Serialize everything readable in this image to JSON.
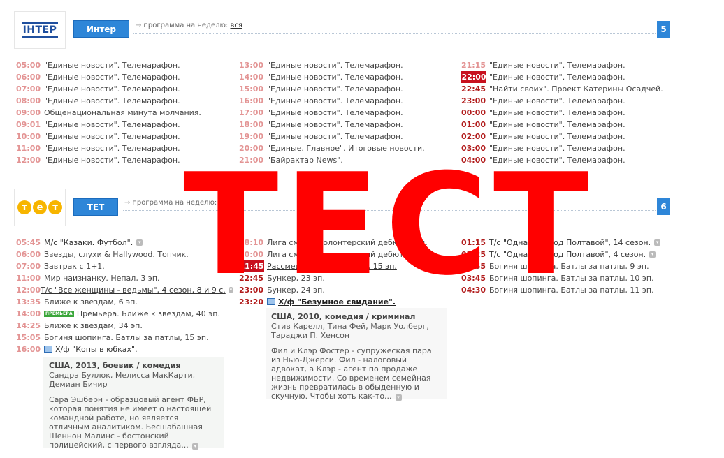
{
  "channels": [
    {
      "logo_text": "ІНТЕР",
      "button_label": "Интер",
      "week_label": "программа на неделю:",
      "week_link": "вся",
      "number": "5",
      "columns": [
        [
          {
            "time": "05:00",
            "title": "\"Единые новости\". Телемарафон."
          },
          {
            "time": "06:00",
            "title": "\"Единые новости\". Телемарафон."
          },
          {
            "time": "07:00",
            "title": "\"Единые новости\". Телемарафон."
          },
          {
            "time": "08:00",
            "title": "\"Единые новости\". Телемарафон."
          },
          {
            "time": "09:00",
            "title": "Общенациональная минута молчания."
          },
          {
            "time": "09:01",
            "title": "\"Единые новости\". Телемарафон."
          },
          {
            "time": "10:00",
            "title": "\"Единые новости\". Телемарафон."
          },
          {
            "time": "11:00",
            "title": "\"Единые новости\". Телемарафон."
          },
          {
            "time": "12:00",
            "title": "\"Единые новости\". Телемарафон."
          }
        ],
        [
          {
            "time": "13:00",
            "title": "\"Единые новости\". Телемарафон."
          },
          {
            "time": "14:00",
            "title": "\"Единые новости\". Телемарафон."
          },
          {
            "time": "15:00",
            "title": "\"Единые новости\". Телемарафон."
          },
          {
            "time": "16:00",
            "title": "\"Единые новости\". Телемарафон."
          },
          {
            "time": "17:00",
            "title": "\"Единые новости\". Телемарафон."
          },
          {
            "time": "18:00",
            "title": "\"Единые новости\". Телемарафон."
          },
          {
            "time": "19:00",
            "title": "\"Единые новости\". Телемарафон."
          },
          {
            "time": "20:00",
            "title": "\"Единые. Главное\". Итоговые новости."
          },
          {
            "time": "21:00",
            "title": "\"Байрактар News\"."
          }
        ],
        [
          {
            "time": "21:15",
            "title": "\"Единые новости\". Телемарафон."
          },
          {
            "time": "22:00",
            "title": "\"Единые новости\". Телемарафон."
          },
          {
            "time": "22:45",
            "title": "\"Найти своих\". Проект Катерины Осадчей."
          },
          {
            "time": "23:00",
            "title": "\"Единые новости\". Телемарафон."
          },
          {
            "time": "00:00",
            "title": "\"Единые новости\". Телемарафон."
          },
          {
            "time": "01:00",
            "title": "\"Единые новости\". Телемарафон."
          },
          {
            "time": "02:00",
            "title": "\"Единые новости\". Телемарафон."
          },
          {
            "time": "03:00",
            "title": "\"Единые новости\". Телемарафон."
          },
          {
            "time": "04:00",
            "title": "\"Единые новости\". Телемарафон."
          }
        ]
      ]
    },
    {
      "logo_letters": [
        "т",
        "е",
        "т"
      ],
      "button_label": "ТЕТ",
      "week_label": "программа на неделю:",
      "week_link": "вся",
      "number": "6",
      "columns": [
        [
          {
            "time": "05:45",
            "title": "М/с \"Казаки. Футбол\"."
          },
          {
            "time": "06:00",
            "title": "Звезды, слухи & Hallywood. Топчик."
          },
          {
            "time": "07:00",
            "title": "Завтрак с 1+1."
          },
          {
            "time": "11:00",
            "title": "Мир наизнанку. Непал, 3 эп."
          },
          {
            "time": "12:00",
            "title": "Т/с \"Все женщины - ведьмы\", 4 сезон, 8 и 9 с."
          },
          {
            "time": "13:35",
            "title": "Ближе к звездам, 6 эп."
          },
          {
            "time": "14:00",
            "badge": "ПРЕМЬЕРА",
            "title": "Премьера. Ближе к звездам, 40 эп."
          },
          {
            "time": "14:25",
            "title": "Ближе к звездам, 34 эп."
          },
          {
            "time": "15:05",
            "title": "Богиня шопинга. Батлы за патлы, 15 эп."
          },
          {
            "time": "16:00",
            "title": "Х/ф \"Копы в юбках\"."
          }
        ],
        [
          {
            "time": "18:10",
            "title": "Лига смеха. Волонтерский дебют, 2 эп."
          },
          {
            "time": "20:00",
            "title": "Лига смеха. Волонтерский дебют, 3 эп."
          },
          {
            "time": "21:45",
            "title": "Рассмеши комика. Сезон, 15 эп."
          },
          {
            "time": "22:45",
            "title": "Бункер, 23 эп."
          },
          {
            "time": "23:00",
            "title": "Бункер, 24 эп."
          },
          {
            "time": "23:20",
            "title": "Х/ф \"Безумное свидание\"."
          }
        ],
        [
          {
            "time": "01:15",
            "title": "Т/с \"Однажды под Полтавой\", 14 сезон."
          },
          {
            "time": "02:25",
            "title": "Т/с \"Однажды под Полтавой\", 4 сезон."
          },
          {
            "time": "02:55",
            "title": "Богиня шопинга. Батлы за патлы, 9 эп."
          },
          {
            "time": "03:45",
            "title": "Богиня шопинга. Батлы за патлы, 10 эп."
          },
          {
            "time": "04:30",
            "title": "Богиня шопинга. Батлы за патлы, 11 эп."
          }
        ]
      ],
      "films": [
        {
          "meta": "США, 2013, боевик / комедия",
          "cast": "Сандра Буллок, Мелисса МакКарти, Демиан Бичир",
          "description": "Сара Эшберн - образцовый агент ФБР, которая понятия не имеет о настоящей командной работе, но является отличным аналитиком. Бесшабашная Шеннон Малинс - бостонский полицейский, с первого взгляда..."
        },
        {
          "meta": "США, 2010, комедия / криминал",
          "cast": "Стив Карелл, Тина Фей, Марк Уолберг, Тараджи П. Хенсон",
          "description": "Фил и Клэр Фостер - супружеская пара из Нью-Джерси. Фил - налоговый адвокат, а Клэр - агент по продаже недвижимости. Со временем семейная жизнь превратилась в обыденную и скучную. Чтобы хоть как-то..."
        }
      ]
    }
  ],
  "overlay_text": "ТЕСТ",
  "colors": {
    "accent": "#2e86d8",
    "time": "#e39494",
    "current": "#c8101e",
    "stamp": "#ff0000"
  }
}
